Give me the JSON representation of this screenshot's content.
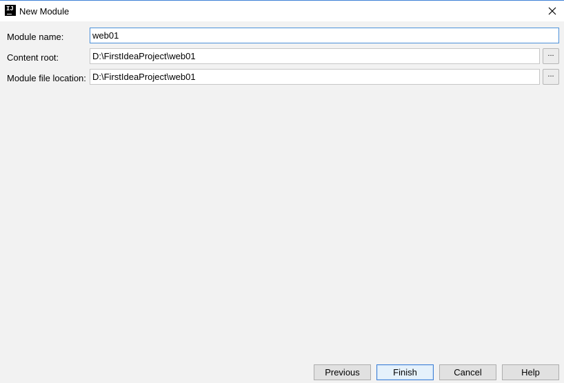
{
  "window": {
    "title": "New Module",
    "icon": "intellij-idea-icon"
  },
  "form": {
    "module_name": {
      "label": "Module name:",
      "value": "web01"
    },
    "content_root": {
      "label": "Content root:",
      "value": "D:\\FirstIdeaProject\\web01",
      "browse_label": "..."
    },
    "module_file_location": {
      "label": "Module file location:",
      "value": "D:\\FirstIdeaProject\\web01",
      "browse_label": "..."
    }
  },
  "buttons": {
    "previous": "Previous",
    "finish": "Finish",
    "cancel": "Cancel",
    "help": "Help"
  },
  "colors": {
    "accent": "#3c7fd6",
    "background": "#f2f2f2"
  }
}
